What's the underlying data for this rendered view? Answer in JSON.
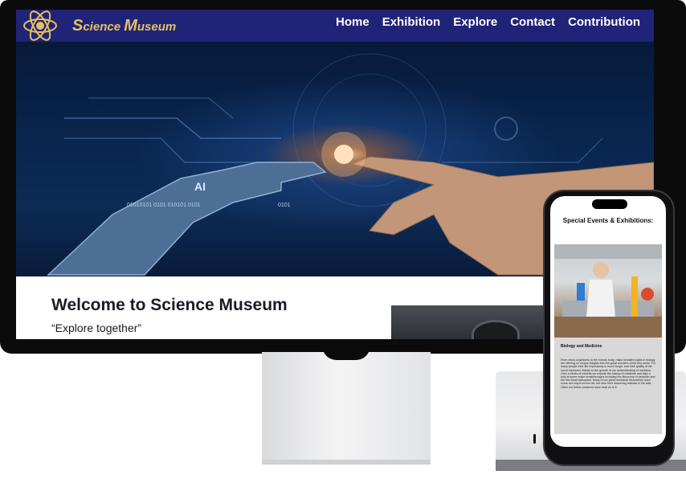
{
  "desktop_site": {
    "brand": {
      "first_cap": "S",
      "first_rest": "cience",
      "second_cap": "M",
      "second_rest": "useum"
    },
    "nav": [
      {
        "label": "Home"
      },
      {
        "label": "Exhibition"
      },
      {
        "label": "Explore"
      },
      {
        "label": "Contact"
      },
      {
        "label": "Contribution"
      }
    ],
    "hero": {
      "ai_text": "AI",
      "binary_left": "01010101 0101 010101  0101",
      "binary_right": "0101"
    },
    "welcome": {
      "title": "Welcome to Science Museum",
      "tagline": "“Explore together”"
    }
  },
  "mobile_site": {
    "heading": "Special Events & Exhibitions:",
    "card_title": "Biology and Medicine",
    "card_body": "From micro-organisms to the human body, major breakthroughs in biology are offering us unique insights into the great wonders of the tiny world. For many people their life expectancy is much longer and their quality of life much improved, thanks to the growth of our understanding of medicine. Over a series of exhibits we explore the history of medicine and take a look at some major breakthroughs including the discovery of penicillin and the first heart transplant. Many of our great medicinal discoveries have come not only from the lab, but also from observing animals in the wild. Often our fellow creatures have beat us to it."
  },
  "colors": {
    "nav_background": "#202478",
    "brand_gold": "#e6c060",
    "hero_dark_blue": "#0a2650"
  },
  "icons": [
    "atom-logo-icon"
  ]
}
